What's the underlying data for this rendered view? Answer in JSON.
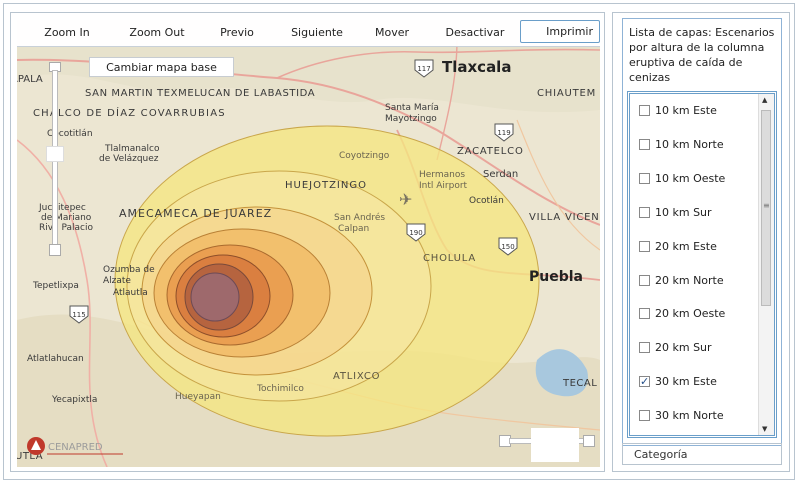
{
  "toolbar": {
    "zoom_in": "Zoom In",
    "zoom_out": "Zoom Out",
    "previous": "Previo",
    "next": "Siguiente",
    "pan": "Mover",
    "deactivate": "Desactivar",
    "print": "Imprimir"
  },
  "map": {
    "basemap_button": "Cambiar mapa base",
    "labels": {
      "tlaxcala": "Tlaxcala",
      "apala": "APALA",
      "san_martin": "SAN MARTIN TEXMELUCAN DE LABASTIDA",
      "chiautem": "CHIAUTEM",
      "chalco": "CHALCO DE DÍAZ COVARRUBIAS",
      "santa_maria": "Santa María",
      "mayotzingo": "Mayotzingo",
      "cocotitlan": "Cocotitlán",
      "tlalmanalco": "Tlalmanalco",
      "velazquez": "de Velázquez",
      "coyotzingo": "Coyotzingo",
      "zacatelco": "ZACATELCO",
      "hermanos": "Hermanos",
      "intl": "Intl Airport",
      "serdan": "Serdan",
      "huejotzingo": "HUEJOTZINGO",
      "juchitepec": "Juchitepec",
      "de_mariano": "de Mariano",
      "riva_palacio": "Riva Palacio",
      "amecameca": "AMECAMECA DE JUAREZ",
      "san_andres": "San Andrés",
      "calpan": "Calpan",
      "ocotlan": "Ocotlán",
      "villa_vicen": "VILLA VICEN",
      "cholula": "CHOLULA",
      "puebla": "Puebla",
      "tepetlixpa": "Tepetlixpa",
      "ozumba": "Ozumba de",
      "alzate": "Alzate",
      "atlautla": "Atlautla",
      "atlatlahucan": "Atlatlahucan",
      "atlixco": "ATLIXCO",
      "tecal": "TECAL",
      "yecapixtla": "Yecapixtla",
      "hueyapan": "Hueyapan",
      "tochimilco": "Tochimilco",
      "cuautla": "UTLA",
      "cenapred": "CENAPRED"
    },
    "shields": [
      "117",
      "119",
      "190",
      "150",
      "115"
    ],
    "colors": {
      "outer_ring": "#f5e680",
      "ring2": "#f5d38c",
      "ring3": "#f3b661",
      "ring4": "#e6894a",
      "ring5": "#c9603b",
      "core": "#9a6a74"
    }
  },
  "layers": {
    "title": "Lista de capas: Escenarios por altura de la columna eruptiva de caída de cenizas",
    "items": [
      {
        "label": "10 km Este",
        "checked": false
      },
      {
        "label": "10 km Norte",
        "checked": false
      },
      {
        "label": "10 km Oeste",
        "checked": false
      },
      {
        "label": "10 km Sur",
        "checked": false
      },
      {
        "label": "20 km Este",
        "checked": false
      },
      {
        "label": "20 km Norte",
        "checked": false
      },
      {
        "label": "20 km Oeste",
        "checked": false
      },
      {
        "label": "20 km Sur",
        "checked": false
      },
      {
        "label": "30 km Este",
        "checked": true
      },
      {
        "label": "30 km Norte",
        "checked": false
      }
    ]
  },
  "category_tab": "Categoría"
}
